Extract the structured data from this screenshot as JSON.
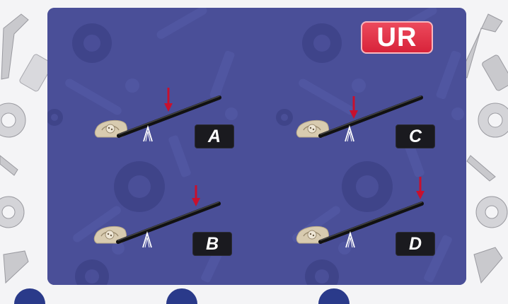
{
  "badge": {
    "label": "UR",
    "color": "#e23248"
  },
  "options": [
    {
      "id": "A",
      "label": "A"
    },
    {
      "id": "B",
      "label": "B"
    },
    {
      "id": "C",
      "label": "C"
    },
    {
      "id": "D",
      "label": "D"
    }
  ],
  "colors": {
    "panel": "#4a4f98",
    "arrow": "#c8102e",
    "lever": "#1b1b1b",
    "label_bg": "#1a1a1f"
  },
  "icons": [
    "wrench-icon",
    "gear-icon",
    "bolt-icon",
    "nut-icon",
    "rock-icon",
    "fulcrum-icon",
    "force-arrow-icon"
  ]
}
